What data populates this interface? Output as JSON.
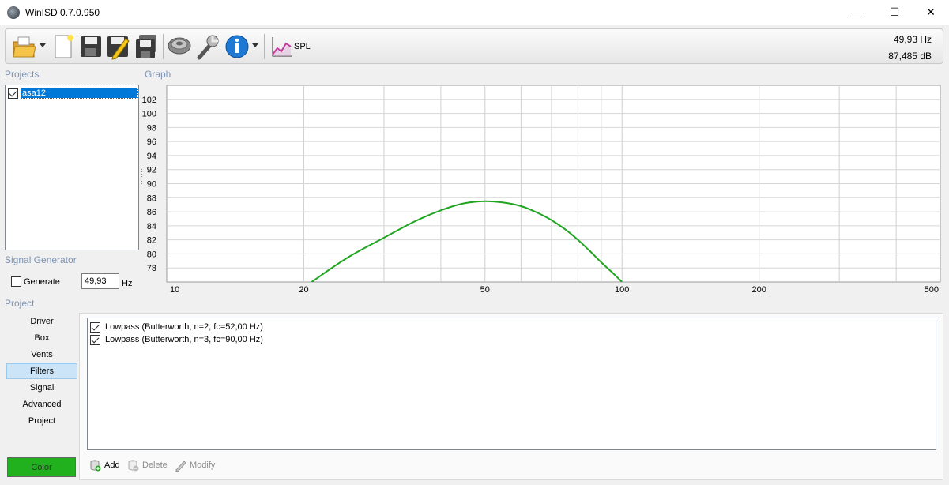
{
  "window": {
    "title": "WinISD 0.7.0.950",
    "controls": {
      "minimize": "—",
      "maximize": "☐",
      "close": "✕"
    }
  },
  "toolbar": {
    "buttons": [
      "open-folder-icon",
      "new-document-icon",
      "save-icon",
      "edit-icon",
      "save-as-icon",
      "driver-icon",
      "tools-wrench-icon",
      "info-icon",
      "spl-chart-icon"
    ],
    "spl_label": "SPL",
    "readout": {
      "frequency": "49,93 Hz",
      "level": "87,485 dB"
    }
  },
  "projects": {
    "header": "Projects",
    "items": [
      {
        "name": "asa12",
        "checked": true,
        "selected": true
      }
    ]
  },
  "signal_generator": {
    "header": "Signal Generator",
    "generate_label": "Generate",
    "generate_checked": false,
    "frequency_value": "49,93",
    "unit": "Hz"
  },
  "graph": {
    "header": "Graph"
  },
  "chart_data": {
    "type": "line",
    "xscale": "log",
    "xlim": [
      10,
      500
    ],
    "ylim": [
      76,
      104
    ],
    "x_ticks": [
      10,
      20,
      50,
      100,
      200,
      500
    ],
    "y_ticks": [
      78,
      80,
      82,
      84,
      86,
      88,
      90,
      92,
      94,
      96,
      98,
      100,
      102
    ],
    "grid": true,
    "series": [
      {
        "color": "#1fa51f",
        "x": [
          20.8,
          25,
          30,
          35,
          40,
          45,
          50,
          55,
          60,
          65,
          70,
          75,
          80,
          85,
          90,
          95,
          100
        ],
        "y": [
          76,
          79.5,
          82.3,
          84.6,
          86.2,
          87.2,
          87.5,
          87.3,
          86.8,
          85.9,
          84.8,
          83.5,
          82.0,
          80.4,
          78.8,
          77.4,
          76
        ]
      }
    ]
  },
  "project_nav": {
    "header": "Project",
    "items": [
      "Driver",
      "Box",
      "Vents",
      "Filters",
      "Signal",
      "Advanced",
      "Project"
    ],
    "selected": "Filters"
  },
  "filters": {
    "items": [
      {
        "label": "Lowpass (Butterworth, n=2, fc=52,00 Hz)",
        "checked": true
      },
      {
        "label": "Lowpass (Butterworth, n=3, fc=90,00 Hz)",
        "checked": true
      }
    ],
    "actions": {
      "add": "Add",
      "delete": "Delete",
      "modify": "Modify"
    }
  },
  "color_button": {
    "label": "Color",
    "color": "#22b11e"
  }
}
